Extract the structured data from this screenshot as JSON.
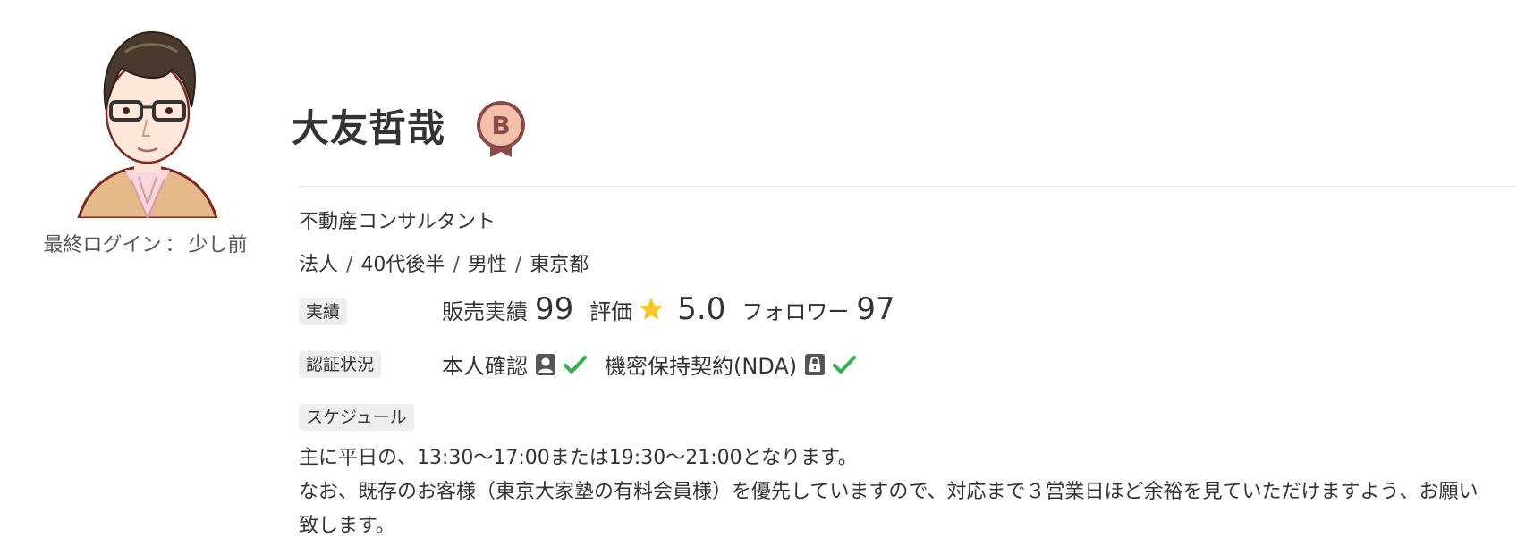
{
  "profile": {
    "name": "大友哲哉",
    "badge_letter": "B",
    "last_login_label": "最終ログイン",
    "last_login_sep": "：",
    "last_login_value": "少し前",
    "occupation": "不動産コンサルタント",
    "attributes": [
      "法人",
      "40代後半",
      "男性",
      "東京都"
    ],
    "attribute_separator": "/"
  },
  "achievements": {
    "tag": "実績",
    "sales_label": "販売実績",
    "sales_value": "99",
    "rating_label": "評価",
    "rating_value": "5.0",
    "followers_label": "フォロワー",
    "followers_value": "97"
  },
  "certification": {
    "tag": "認証状況",
    "identity_label": "本人確認",
    "nda_label": "機密保持契約(NDA)",
    "check_color": "#2fb34a"
  },
  "schedule": {
    "tag": "スケジュール",
    "line1": "主に平日の、13:30〜17:00または19:30〜21:00となります。",
    "line2": "なお、既存のお客様（東京大家塾の有料会員様）を優先していますので、対応まで３営業日ほど余裕を見ていただけますよう、お願い致します。"
  },
  "colors": {
    "badge_fill": "#f3c1aa",
    "badge_stroke": "#8b4a4a",
    "star": "#f6c824",
    "tag_bg": "#eeeeee"
  },
  "icons": {
    "avatar": "user-avatar",
    "badge": "rank-badge-icon",
    "star": "star-icon",
    "identity": "id-card-icon",
    "nda": "lock-icon",
    "check": "checkmark-icon"
  }
}
